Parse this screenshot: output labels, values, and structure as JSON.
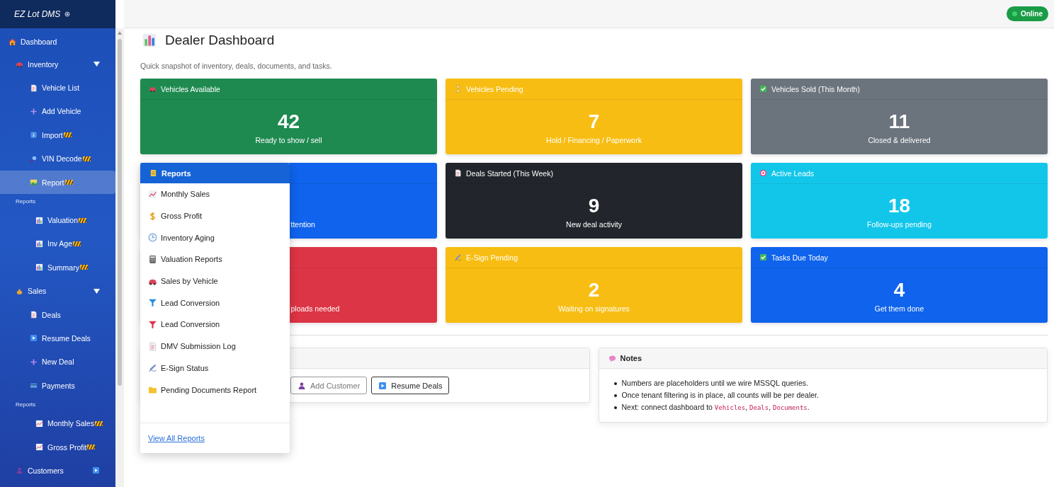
{
  "app": {
    "title": "EZ Lot DMS"
  },
  "sidebar": {
    "items": [
      {
        "label": "Dashboard",
        "selected": false
      },
      {
        "label": "Inventory",
        "selected": false,
        "expanded": true,
        "children": [
          {
            "label": "Vehicle List",
            "selected": false,
            "wip": false
          },
          {
            "label": "Add Vehicle",
            "selected": false,
            "wip": false
          },
          {
            "label": "Import",
            "selected": false,
            "wip": true
          },
          {
            "label": "VIN Decode",
            "selected": false,
            "wip": true
          },
          {
            "label": "Report",
            "selected": true,
            "wip": true
          },
          {
            "kind": "heading",
            "label": "Reports",
            "children": [
              {
                "label": "Valuation",
                "selected": false,
                "wip": true
              },
              {
                "label": "Inv Age",
                "selected": false,
                "wip": true
              },
              {
                "label": "Summary",
                "selected": false,
                "wip": true
              }
            ]
          }
        ]
      },
      {
        "label": "Sales",
        "selected": false,
        "expanded": true,
        "children": [
          {
            "label": "Deals",
            "selected": false,
            "wip": false
          },
          {
            "label": "Resume Deals",
            "selected": false,
            "wip": false
          },
          {
            "label": "New Deal",
            "selected": false,
            "wip": false
          },
          {
            "label": "Payments",
            "selected": false,
            "wip": false
          },
          {
            "kind": "heading",
            "label": "Reports",
            "children": [
              {
                "label": "Monthly Sales",
                "selected": false,
                "wip": true
              },
              {
                "label": "Gross Profit",
                "selected": false,
                "wip": true
              }
            ]
          }
        ]
      },
      {
        "label": "Customers",
        "selected": false,
        "expanded": false
      }
    ]
  },
  "status": {
    "label": "Online",
    "color": "#1a9c46"
  },
  "page": {
    "title": "Dealer Dashboard",
    "subtitle": "Quick snapshot of inventory, deals, documents, and tasks."
  },
  "cards": [
    {
      "title": "Vehicles Available",
      "value": "42",
      "caption": "Ready to show / sell",
      "color": "#1e8a50"
    },
    {
      "title": "Vehicles Pending",
      "value": "7",
      "caption": "Hold / Financing / Paperwork",
      "color": "#f7bd12"
    },
    {
      "title": "Vehicles Sold (This Month)",
      "value": "11",
      "caption": "Closed & delivered",
      "color": "#6b737c"
    },
    {
      "caption": "ttention",
      "color": "#0f63ec"
    },
    {
      "title": "Deals Started (This Week)",
      "value": "9",
      "caption": "New deal activity",
      "color": "#22252b"
    },
    {
      "title": "Active Leads",
      "value": "18",
      "caption": "Follow-ups pending",
      "color": "#12c6ea"
    },
    {
      "caption": "ploads needed",
      "color": "#dc3545"
    },
    {
      "title": "E-Sign Pending",
      "value": "2",
      "caption": "Waiting on signatures",
      "color": "#f7bd12"
    },
    {
      "title": "Tasks Due Today",
      "value": "4",
      "caption": "Get them done",
      "color": "#0f63ec"
    }
  ],
  "quick_actions": {
    "buttons": [
      "Add Customer",
      "Resume Deals"
    ]
  },
  "notes": {
    "title": "Notes",
    "items": [
      [
        {
          "text": "Numbers are placeholders until we wire MSSQL queries."
        }
      ],
      [
        {
          "text": "Once tenant filtering is in place, all counts will be per dealer."
        }
      ],
      [
        {
          "text": "Next: connect dashboard to "
        },
        {
          "code": "Vehicles"
        },
        {
          "text": ", "
        },
        {
          "code": "Deals"
        },
        {
          "text": ", "
        },
        {
          "code": "Documents"
        },
        {
          "text": "."
        }
      ]
    ]
  },
  "reports_menu": {
    "open": true,
    "title": "Reports",
    "items": [
      "Monthly Sales",
      "Gross Profit",
      "Inventory Aging",
      "Valuation Reports",
      "Sales by Vehicle",
      "Lead Conversion",
      "Lead Conversion",
      "DMV Submission Log",
      "E-Sign Status",
      "Pending Documents Report"
    ],
    "footer_link": "View All Reports"
  }
}
